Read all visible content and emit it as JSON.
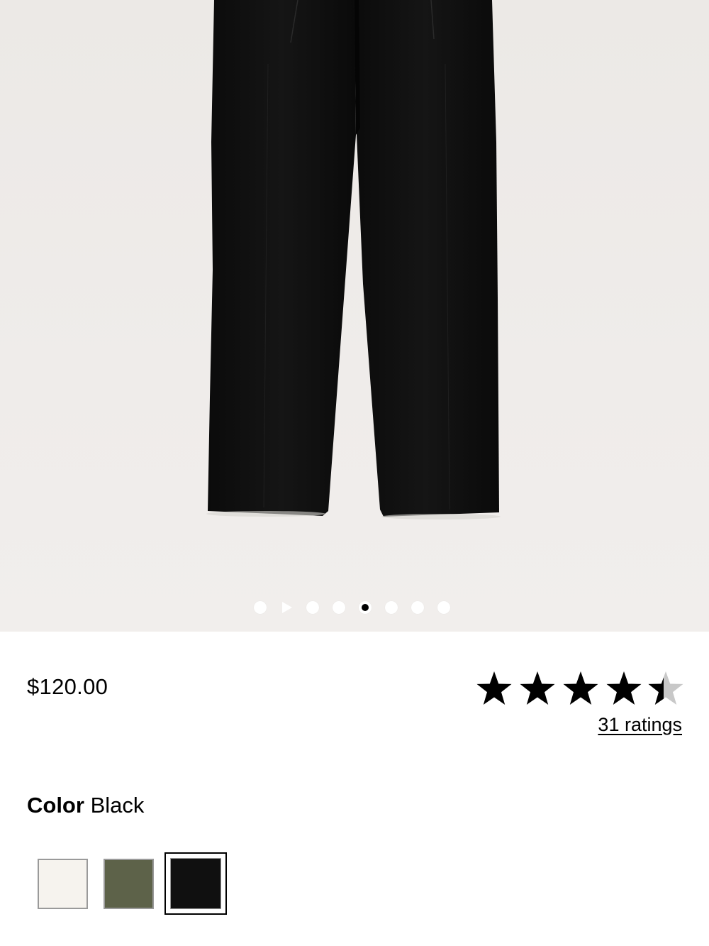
{
  "gallery": {
    "slide_count": 8,
    "active_index": 4,
    "has_video_slide": true
  },
  "product": {
    "price": "$120.00",
    "rating": 4.5,
    "rating_max": 5,
    "ratings_link": "31 ratings"
  },
  "color": {
    "label": "Color",
    "selected": "Black",
    "swatches": [
      {
        "name": "Cream",
        "hex": "#f6f3ee"
      },
      {
        "name": "Olive",
        "hex": "#5d6249"
      },
      {
        "name": "Black",
        "hex": "#101010"
      }
    ]
  },
  "colors": {
    "background_image": "#ece9e6",
    "star_fill": "#000000",
    "star_empty": "#c8c8c8"
  }
}
